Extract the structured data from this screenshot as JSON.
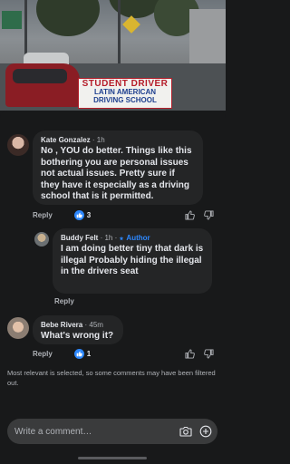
{
  "photo": {
    "banner_line1": "STUDENT DRIVER",
    "banner_line2": "LATIN AMERICAN",
    "banner_line3": "DRIVING SCHOOL"
  },
  "comments": [
    {
      "name": "Kate Gonzalez",
      "time": "· 1h",
      "text": "No , YOU do better. Things like this bothering you are personal issues not actual issues. Pretty sure if they have it especially as a driving school that is it permitted.",
      "reply_label": "Reply",
      "reaction_count": "3"
    },
    {
      "name": "Buddy Felt",
      "time": "· 1h ·",
      "author_label": "Author",
      "text": "I am doing better tiny that dark is illegal Probably hiding the illegal in the drivers seat",
      "reply_label": "Reply"
    },
    {
      "name": "Bebe Rivera",
      "time": "· 45m",
      "text": "What's wrong it?",
      "reply_label": "Reply",
      "reaction_count": "1"
    }
  ],
  "notice": "Most relevant is selected, so some comments may have been filtered out.",
  "composer": {
    "placeholder": "Write a comment…"
  },
  "colors": {
    "background": "#18191a",
    "bubble": "#242526",
    "accent": "#2d88ff"
  }
}
